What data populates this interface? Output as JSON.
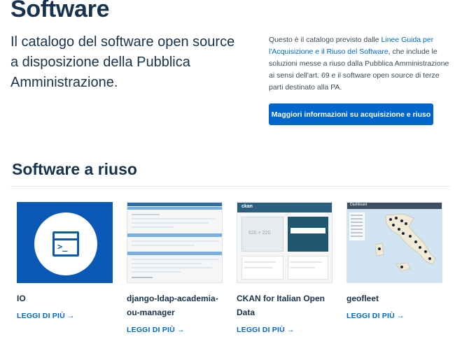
{
  "header": {
    "title": "Software",
    "lead": "Il catalogo del software open source a disposizione della Pubblica Amministrazione."
  },
  "info": {
    "text_before": "Questo è il catalogo previsto dalle ",
    "link": "Linee Guida per l'Acquisizione e il Riuso del Software",
    "text_after": ", che include le soluzioni messe a riuso dalla Pubblica Amministrazione ai sensi dell'art. 69 e il software open source di terze parti destinato alla PA.",
    "cta_label": "Maggiori informazioni su acquisizione e riuso"
  },
  "section": {
    "title": "Software a riuso"
  },
  "cards": [
    {
      "name": "IO",
      "more": "LEGGI DI PIÙ →",
      "thumb": "app-window-icon"
    },
    {
      "name": "django-ldap-academia-ou-manager",
      "more": "LEGGI DI PIÙ →",
      "thumb": "admin-screenshot"
    },
    {
      "name": "CKAN for Italian Open Data",
      "more": "LEGGI DI PIÙ →",
      "thumb": "ckan-screenshot",
      "thumb_placeholder": "620 × 220",
      "thumb_logo": "ckan"
    },
    {
      "name": "geofleet",
      "more": "LEGGI DI PIÙ →",
      "thumb": "map-screenshot",
      "thumb_logo": "Dashboard"
    }
  ],
  "colors": {
    "primary": "#0066cc",
    "heading": "#17324d",
    "io_blue": "#0a58b5"
  }
}
